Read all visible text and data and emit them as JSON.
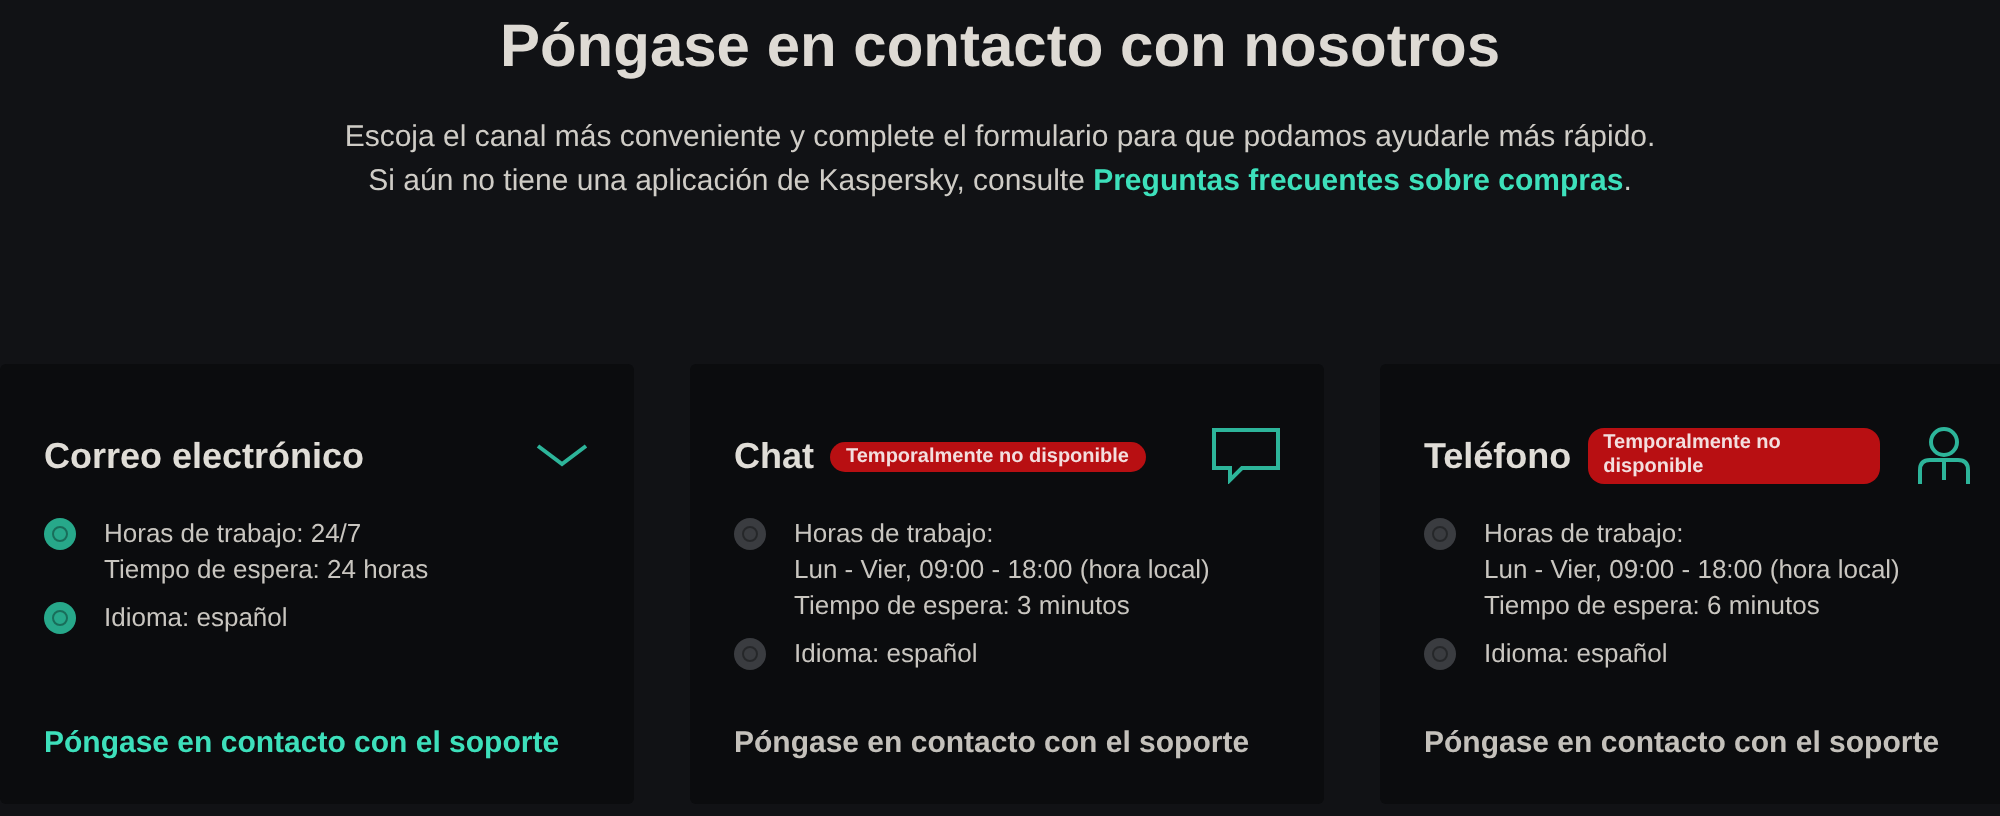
{
  "heading": "Póngase en contacto con nosotros",
  "intro": "Escoja el canal más conveniente y complete el formulario para que podamos ayudarle más rápido.",
  "faq_note": {
    "before": "Si aún no tiene una aplicación de Kaspersky, consulte",
    "link": "Preguntas frecuentes sobre compras",
    "after": "."
  },
  "channels": [
    {
      "title": "Correo electrónico",
      "available": true,
      "details": [
        [
          "Horas de trabajo: 24/7",
          "Tiempo de espera: 24 horas"
        ],
        [
          "Idioma: español"
        ]
      ],
      "link": "Póngase en contacto con el soporte"
    },
    {
      "title": "Chat",
      "available": false,
      "badge": "Temporalmente no disponible",
      "details": [
        [
          "Horas de trabajo:",
          "Lun - Vier, 09:00 - 18:00 (hora local)",
          "Tiempo de espera: 3 minutos"
        ],
        [
          "Idioma: español"
        ]
      ],
      "link": "Póngase en contacto con el soporte"
    },
    {
      "title": "Teléfono",
      "available": false,
      "badge": "Temporalmente no disponible",
      "details": [
        [
          "Horas de trabajo:",
          "Lun - Vier, 09:00 - 18:00 (hora local)",
          "Tiempo de espera: 6 minutos"
        ],
        [
          "Idioma: español"
        ]
      ],
      "link": "Póngase en contacto con el soporte"
    }
  ]
}
